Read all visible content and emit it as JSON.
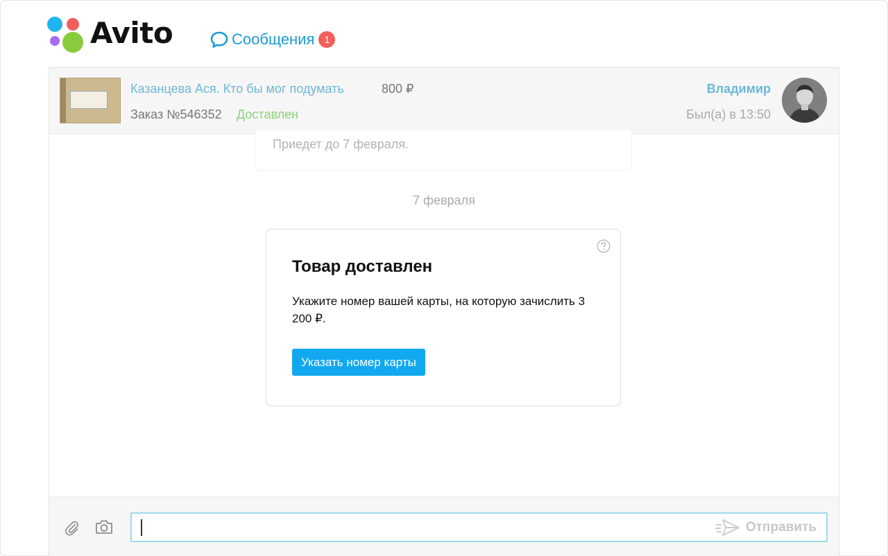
{
  "header": {
    "logo_text": "Avito",
    "messages_label": "Сообщения",
    "messages_badge": "1",
    "icons": [
      "avito-logo-dots",
      "chat-bubble-icon"
    ]
  },
  "chat_header": {
    "product_title": "Казанцева Ася. Кто бы мог подумать",
    "product_price": "800 ₽",
    "order_number": "Заказ №546352",
    "order_status": "Доставлен",
    "seller_name": "Владимир",
    "seller_status": "Был(а) в 13:50"
  },
  "messages": {
    "previous_card_text": "Приедет до 7 февраля.",
    "date_separator": "7 февраля",
    "delivery_card": {
      "title": "Товар доставлен",
      "text": "Укажите номер вашей карты, на которую зачислить 3 200 ₽.",
      "button_label": "Указать номер карты"
    }
  },
  "composer": {
    "input_value": "",
    "send_label": "Отправить",
    "icons": [
      "paperclip-icon",
      "camera-icon",
      "send-icon"
    ]
  },
  "colors": {
    "link_blue": "#6bb8d7",
    "status_green": "#8dd07a",
    "button_blue": "#12a8ef",
    "badge_red": "#f25f5c"
  }
}
